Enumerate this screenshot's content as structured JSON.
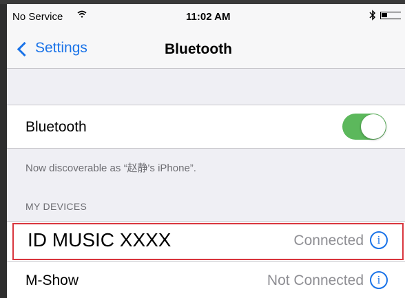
{
  "status_bar": {
    "carrier": "No Service",
    "wifi_icon": "wifi-icon",
    "time": "11:02 AM",
    "bluetooth_icon": "bluetooth-icon",
    "battery_icon": "battery-icon"
  },
  "nav": {
    "back_label": "Settings",
    "title": "Bluetooth"
  },
  "bluetooth_row": {
    "label": "Bluetooth",
    "toggle_on": true,
    "toggle_color": "#5cb85c"
  },
  "discoverable_note": "Now discoverable as “赵静's iPhone”.",
  "my_devices": {
    "header": "MY DEVICES",
    "items": [
      {
        "name": "ID MUSIC XXXX",
        "status": "Connected",
        "info_icon": "info-icon",
        "highlighted": true
      },
      {
        "name": "M-Show",
        "status": "Not Connected",
        "info_icon": "info-icon",
        "highlighted": false
      }
    ]
  },
  "colors": {
    "accent": "#1a73e8",
    "highlight_border": "#d9363e",
    "background": "#efeff4"
  }
}
